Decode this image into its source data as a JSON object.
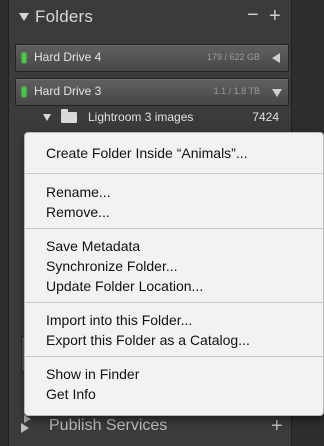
{
  "folders_panel": {
    "title": "Folders",
    "minus_label": "−",
    "plus_label": "+"
  },
  "drives": [
    {
      "name": "Hard Drive 4",
      "size": "179 / 622 GB"
    },
    {
      "name": "Hard Drive 3",
      "size": "1.1 / 1.8 TB"
    }
  ],
  "folder_row": {
    "label": "Lightroom 3 images",
    "count": "7424"
  },
  "context_menu": {
    "groups": [
      [
        "Create Folder Inside “Animals”..."
      ],
      [
        "Rename...",
        "Remove..."
      ],
      [
        "Save Metadata",
        "Synchronize Folder...",
        "Update Folder Location..."
      ],
      [
        "Import into this Folder...",
        "Export this Folder as a Catalog..."
      ],
      [
        "Show in Finder",
        "Get Info"
      ]
    ]
  },
  "publish_services": {
    "title": "Publish Services",
    "plus_label": "+"
  }
}
